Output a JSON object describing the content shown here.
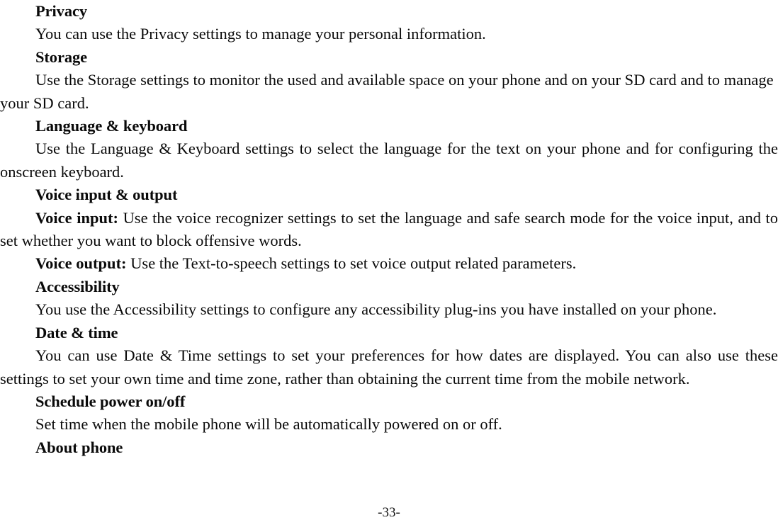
{
  "document": {
    "type": "mobile-phone-user-manual-page",
    "page_number_label": "-33-",
    "sections": [
      {
        "heading": "Privacy",
        "paragraphs": [
          {
            "lead": "",
            "text": "You can use the Privacy settings to manage your personal information.",
            "justified": false
          }
        ]
      },
      {
        "heading": "Storage",
        "paragraphs": [
          {
            "lead": "",
            "text": "Use the Storage settings to monitor the used and available space on your phone and on your SD card and to manage your SD card.",
            "justified": false
          }
        ]
      },
      {
        "heading": "Language & keyboard",
        "paragraphs": [
          {
            "lead": "",
            "text": "Use the Language & Keyboard settings to select the language for the text on your phone and for configuring the onscreen keyboard.",
            "justified": true
          }
        ]
      },
      {
        "heading": "Voice input & output",
        "paragraphs": [
          {
            "lead": "Voice input:",
            "text": "Use the voice recognizer settings to set the language and safe search mode for the voice input, and to set whether you want to block offensive words.",
            "justified": true
          },
          {
            "lead": "Voice output:",
            "text": "Use the Text-to-speech settings to set voice output related parameters.",
            "justified": false
          }
        ]
      },
      {
        "heading": "Accessibility",
        "paragraphs": [
          {
            "lead": "",
            "text": "You use the Accessibility settings to configure any accessibility plug-ins you have installed on your phone.",
            "justified": true
          }
        ]
      },
      {
        "heading": "Date & time",
        "paragraphs": [
          {
            "lead": "",
            "text": "You can use Date & Time settings to set your preferences for how dates are displayed. You can also use these settings to set your own time and time zone, rather than obtaining the current time from the mobile network.",
            "justified": true
          }
        ]
      },
      {
        "heading": "Schedule power on/off",
        "paragraphs": [
          {
            "lead": "",
            "text": "Set time when the mobile phone will be automatically powered on or off.",
            "justified": false
          }
        ]
      },
      {
        "heading": "About phone",
        "paragraphs": []
      }
    ]
  },
  "body": {
    "privacy_heading": "Privacy",
    "privacy_text": "You can use the Privacy settings to manage your personal information.",
    "storage_heading": "Storage",
    "storage_text": "Use the Storage settings to monitor the used and available space on your phone and on your SD card and to manage your SD card.",
    "language_heading": "Language & keyboard",
    "language_text": "Use the Language & Keyboard settings to select the language for the text on your phone and for configuring the onscreen keyboard.",
    "voice_heading": "Voice input & output",
    "voice_input_lead": "Voice input:",
    "voice_input_text": "Use the voice recognizer settings to set the language and safe search mode for the voice input, and to set whether you want to block offensive words.",
    "voice_output_lead": "Voice output:",
    "voice_output_text": "Use the Text-to-speech settings to set voice output related parameters.",
    "accessibility_heading": "Accessibility",
    "accessibility_text": "You use the Accessibility settings to configure any accessibility plug-ins you have installed on your phone.",
    "date_heading": "Date & time",
    "date_text": "You can use Date & Time settings to set your preferences for how dates are displayed. You can also use these settings to set your own time and time zone, rather than obtaining the current time from the mobile network.",
    "schedule_heading": "Schedule power on/off",
    "schedule_text": "Set time when the mobile phone will be automatically powered on or off.",
    "about_heading": "About phone"
  },
  "footer": {
    "page_number": "-33-"
  },
  "colors": {
    "page_background": "#ffffff",
    "text": "#0a0a0a"
  }
}
